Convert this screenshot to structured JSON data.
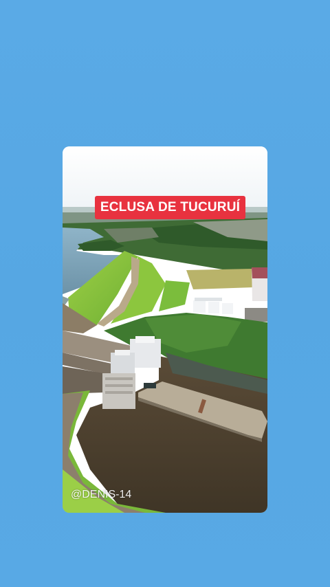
{
  "post": {
    "title": "ECLUSA DE TUCURUÍ",
    "watermark": "@DENIS-14"
  },
  "photo": {
    "subject": "aerial-dam-lock"
  },
  "colors": {
    "background": "#56a8e4",
    "title_badge": "#e8323f",
    "title_text": "#ffffff"
  }
}
